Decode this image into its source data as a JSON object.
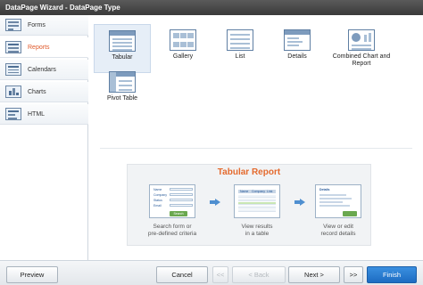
{
  "window": {
    "title": "DataPage Wizard - DataPage Type"
  },
  "sidebar": {
    "items": [
      {
        "label": "Forms",
        "icon": "form-icon",
        "active": false
      },
      {
        "label": "Reports",
        "icon": "report-icon",
        "active": true
      },
      {
        "label": "Calendars",
        "icon": "calendar-icon",
        "active": false
      },
      {
        "label": "Charts",
        "icon": "chart-icon",
        "active": false
      },
      {
        "label": "HTML",
        "icon": "html-icon",
        "active": false
      }
    ]
  },
  "types": [
    {
      "label": "Tabular",
      "icon": "tabular-icon",
      "selected": true
    },
    {
      "label": "Gallery",
      "icon": "gallery-icon",
      "selected": false
    },
    {
      "label": "List",
      "icon": "list-icon",
      "selected": false
    },
    {
      "label": "Details",
      "icon": "details-icon",
      "selected": false
    },
    {
      "label": "Combined Chart and Report",
      "icon": "combined-chart-icon",
      "selected": false
    },
    {
      "label": "Pivot Table",
      "icon": "pivot-table-icon",
      "selected": false
    }
  ],
  "preview": {
    "title": "Tabular Report",
    "steps": [
      {
        "caption_line1": "Search form or",
        "caption_line2": "pre-defined criteria"
      },
      {
        "caption_line1": "View results",
        "caption_line2": "in a table"
      },
      {
        "caption_line1": "View or edit",
        "caption_line2": "record details"
      }
    ],
    "search_fields": [
      "Name",
      "Company",
      "Status",
      "Email"
    ],
    "search_button": "Search",
    "grid_headers": [
      "Name",
      "Company",
      "Link"
    ],
    "details_title": "Details"
  },
  "footer": {
    "preview": "Preview",
    "cancel": "Cancel",
    "first": "<<",
    "back": "< Back",
    "next": "Next >",
    "last": ">>",
    "finish": "Finish"
  },
  "colors": {
    "accent": "#e46a2e",
    "primary_button": "#1d6cc2",
    "arrow": "#4f8fd0"
  }
}
